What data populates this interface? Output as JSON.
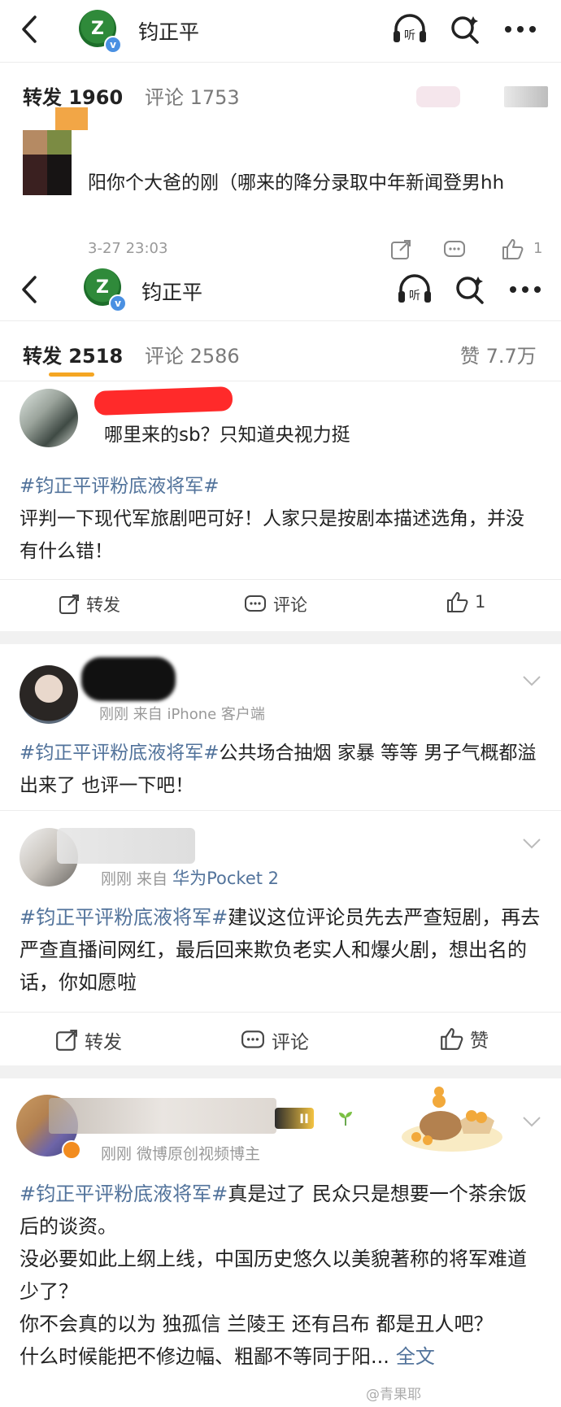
{
  "top": {
    "title": "钧正平",
    "logo_text": "Z",
    "tabs": {
      "repost": "转发 1960",
      "comment": "评论 1753"
    },
    "comment": {
      "text": "阳你个大爸的刚（哪来的降分录取中年新闻登男hh",
      "time": "3-27 23:03",
      "like_count": "1"
    }
  },
  "second": {
    "title": "钧正平",
    "logo_text": "Z",
    "tabs": {
      "repost": "转发 2518",
      "comment": "评论 2586",
      "like": "赞 7.7万"
    },
    "reply_text": "哪里来的sb？只知道央视力挺"
  },
  "posts": [
    {
      "hashtag": "#钧正平评粉底液将军#",
      "text": "评判一下现代军旅剧吧可好！人家只是按剧本描述选角，并没有什么错！",
      "actions": {
        "repost": "转发",
        "comment": "评论",
        "like": "1"
      }
    },
    {
      "meta": "刚刚  来自 iPhone 客户端",
      "hashtag": "#钧正平评粉底液将军#",
      "text": "公共场合抽烟 家暴 等等 男子气概都溢出来了 也评一下吧！"
    },
    {
      "meta_prefix": "刚刚  来自 ",
      "meta_link": "华为Pocket 2",
      "hashtag": "#钧正平评粉底液将军#",
      "text": "建议这位评论员先去严查短剧，再去严查直播间网红，最后回来欺负老实人和爆火剧，想出名的话，你如愿啦",
      "actions": {
        "repost": "转发",
        "comment": "评论",
        "like": "赞"
      }
    },
    {
      "meta": "刚刚  微博原创视频博主",
      "level_badge": "II",
      "hashtag": "#钧正平评粉底液将军#",
      "lines": [
        "真是过了 民众只是想要一个茶余饭后的谈资。",
        "没必要如此上纲上线，中国历史悠久以美貌著称的将军难道少了？",
        "你不会真的以为 独孤信 兰陵王 还有吕布 都是丑人吧？",
        "什么时候能把不修边幅、粗鄙不等同于阳..."
      ],
      "more": "全文"
    }
  ],
  "watermark": "@青果耶"
}
